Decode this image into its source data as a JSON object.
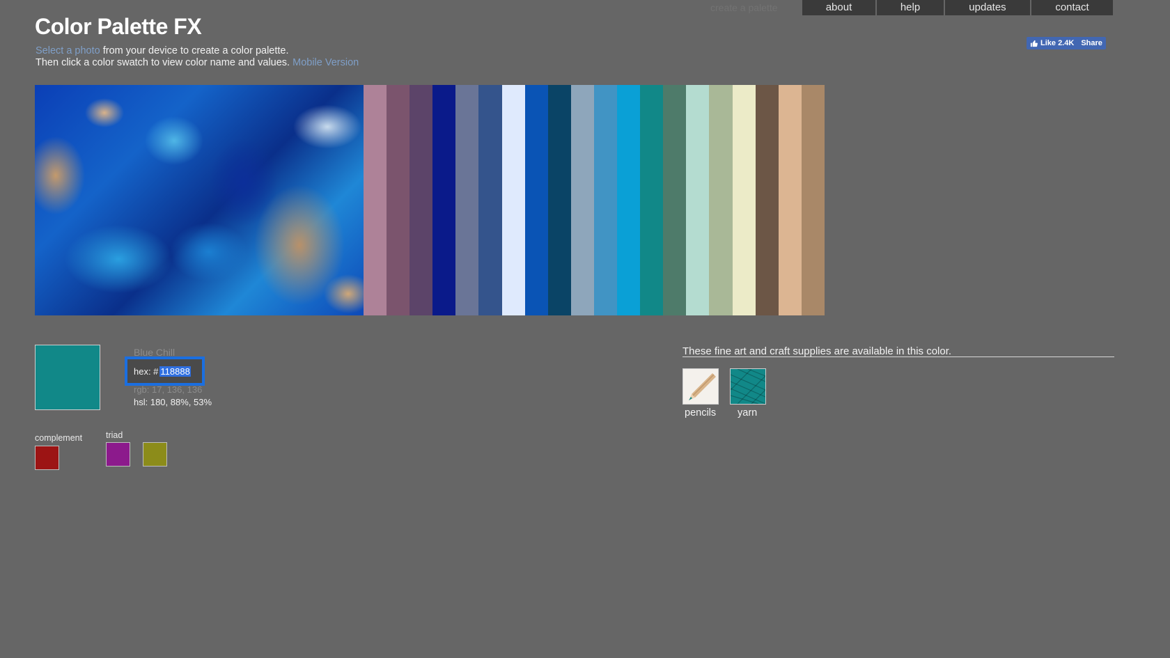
{
  "header": {
    "title": "Color Palette FX",
    "ghost_link": "create a palette",
    "nav": [
      "about",
      "help",
      "updates",
      "contact"
    ]
  },
  "intro": {
    "select_link": "Select a photo",
    "line1_rest": " from your device to create a color palette.",
    "line2": "Then click a color swatch to view color name and values. ",
    "mobile_link": "Mobile Version"
  },
  "social": {
    "like": "Like 2.4K",
    "share": "Share"
  },
  "palette": [
    "#ae8298",
    "#7b546d",
    "#5c4469",
    "#0a1a8a",
    "#6a7597",
    "#34548c",
    "#dfeafd",
    "#0a54b5",
    "#0a4466",
    "#8ea6bb",
    "#4194c4",
    "#0aa0d6",
    "#118888",
    "#4e7b6a",
    "#b4dcd0",
    "#a9b897",
    "#ecebc8",
    "#6c5646",
    "#dcb592",
    "#a98868"
  ],
  "selected": {
    "color": "#118888",
    "name": "Blue Chill",
    "hex_label": "hex: #",
    "hex_value": "118888",
    "rgb": "rgb: 17, 136, 136",
    "hsl": "hsl: 180, 88%, 53%"
  },
  "complement": {
    "label": "complement",
    "colors": [
      "#9c1414"
    ]
  },
  "triad": {
    "label": "triad",
    "colors": [
      "#8c1a8c",
      "#8c8c1a"
    ]
  },
  "supplies": {
    "text": "These fine art and craft supplies are available in this color.",
    "items": [
      {
        "label": "pencils",
        "icon": "colored-pencil-icon"
      },
      {
        "label": "yarn",
        "icon": "yarn-icon"
      }
    ]
  }
}
